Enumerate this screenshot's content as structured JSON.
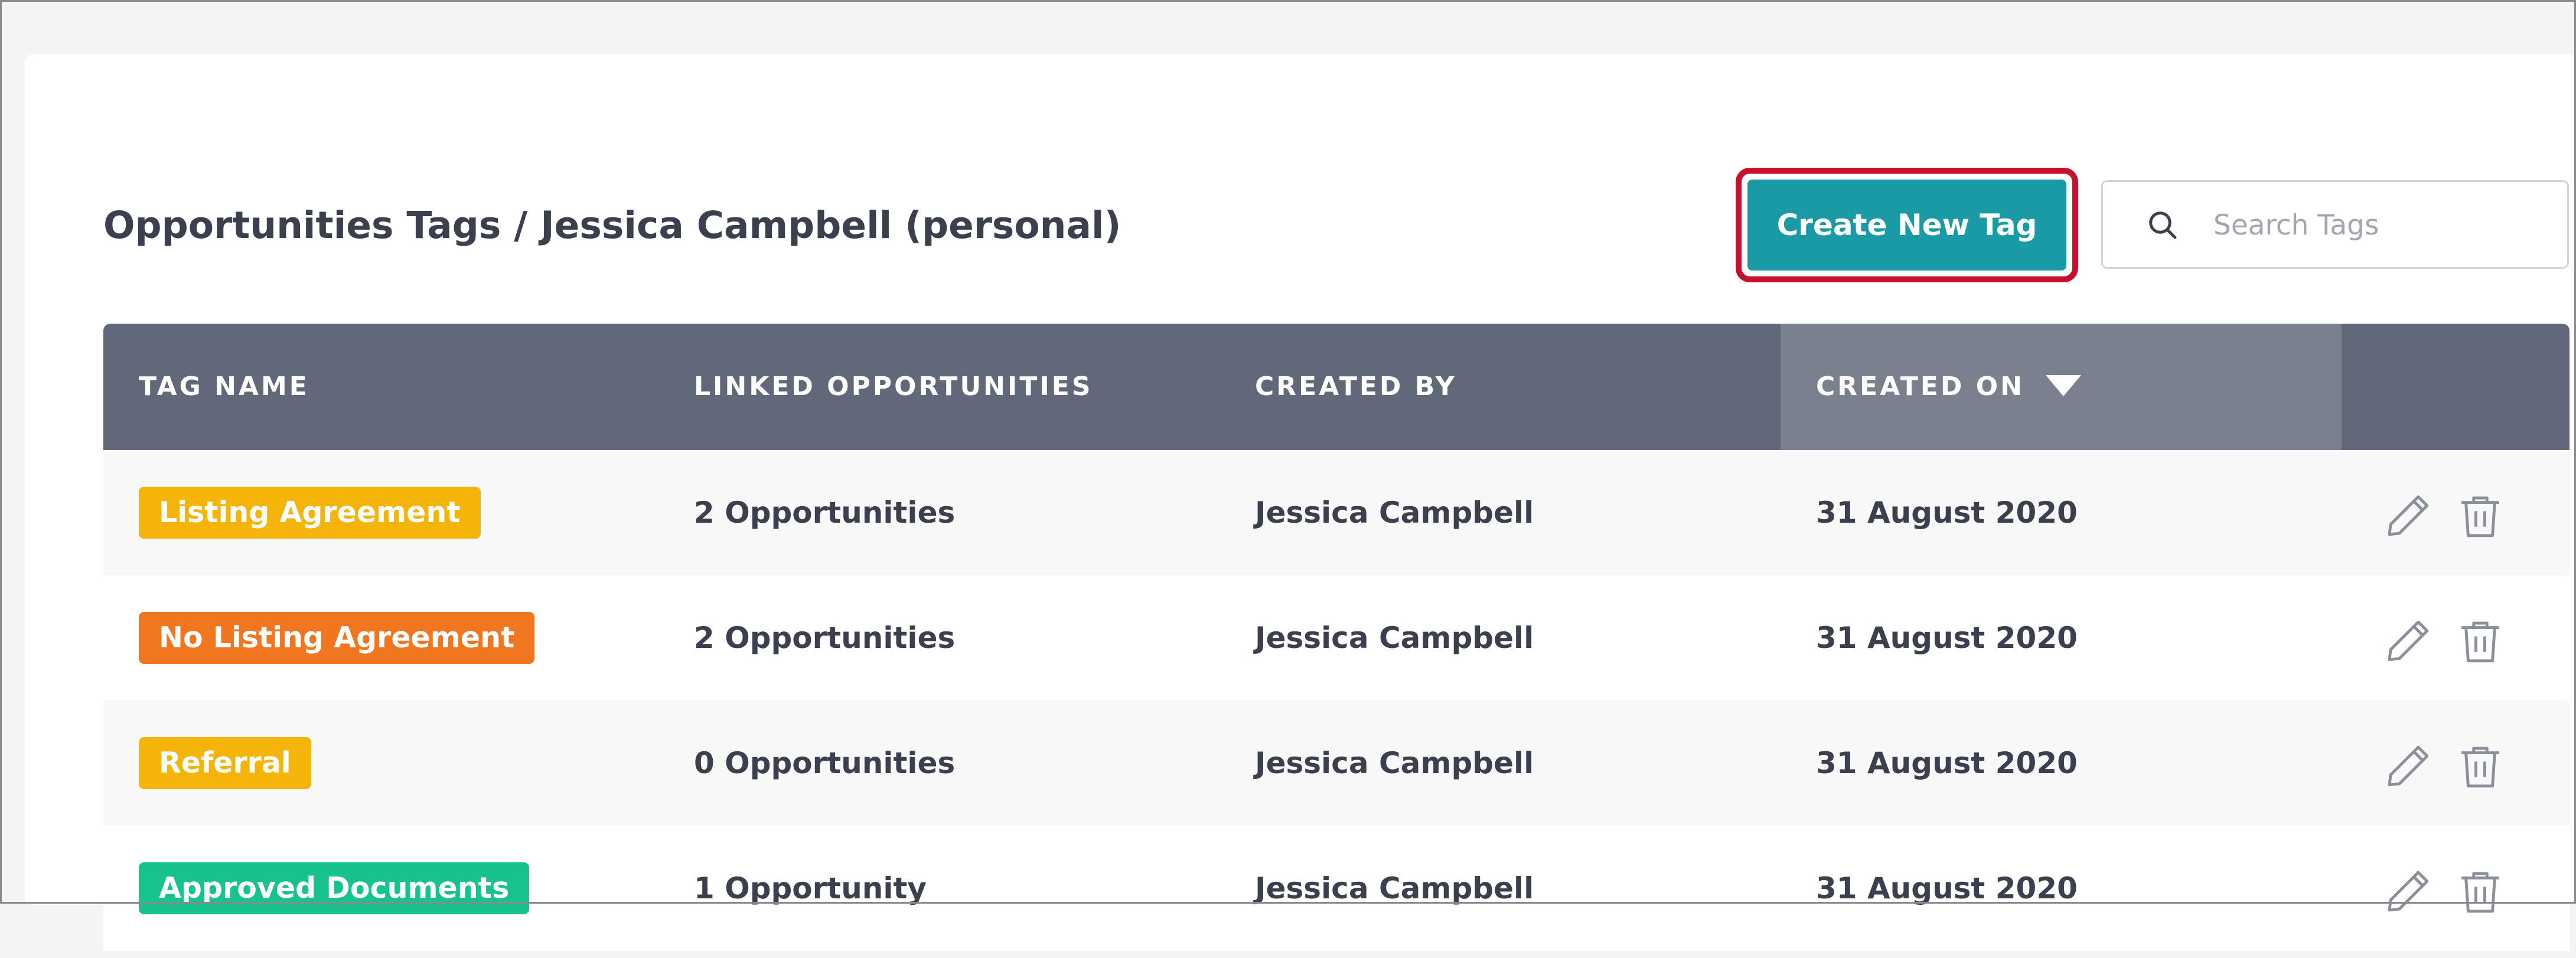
{
  "header": {
    "title": "Opportunities Tags / Jessica Campbell (personal)",
    "create_button": "Create New Tag",
    "search_placeholder": "Search Tags",
    "search_value": ""
  },
  "table": {
    "columns": [
      "TAG NAME",
      "LINKED OPPORTUNITIES",
      "CREATED BY",
      "CREATED ON"
    ],
    "sorted_column": "CREATED ON",
    "sort_direction": "descending",
    "rows": [
      {
        "tag": "Listing Agreement",
        "tag_color": "#f5b40a",
        "linked": "2 Opportunities",
        "created_by": "Jessica Campbell",
        "created_on": "31 August 2020"
      },
      {
        "tag": "No Listing Agreement",
        "tag_color": "#f0761f",
        "linked": "2 Opportunities",
        "created_by": "Jessica Campbell",
        "created_on": "31 August 2020"
      },
      {
        "tag": "Referral",
        "tag_color": "#f5b40a",
        "linked": "0 Opportunities",
        "created_by": "Jessica Campbell",
        "created_on": "31 August 2020"
      },
      {
        "tag": "Approved Documents",
        "tag_color": "#17c28d",
        "linked": "1 Opportunity",
        "created_by": "Jessica Campbell",
        "created_on": "31 August 2020"
      }
    ],
    "row_actions": [
      "pencil-icon",
      "trash-icon"
    ]
  },
  "colors": {
    "accent": "#1a9aa5",
    "highlight_outline": "#c8102e",
    "table_header": "#616879",
    "sorted_header": "#7a808e"
  }
}
